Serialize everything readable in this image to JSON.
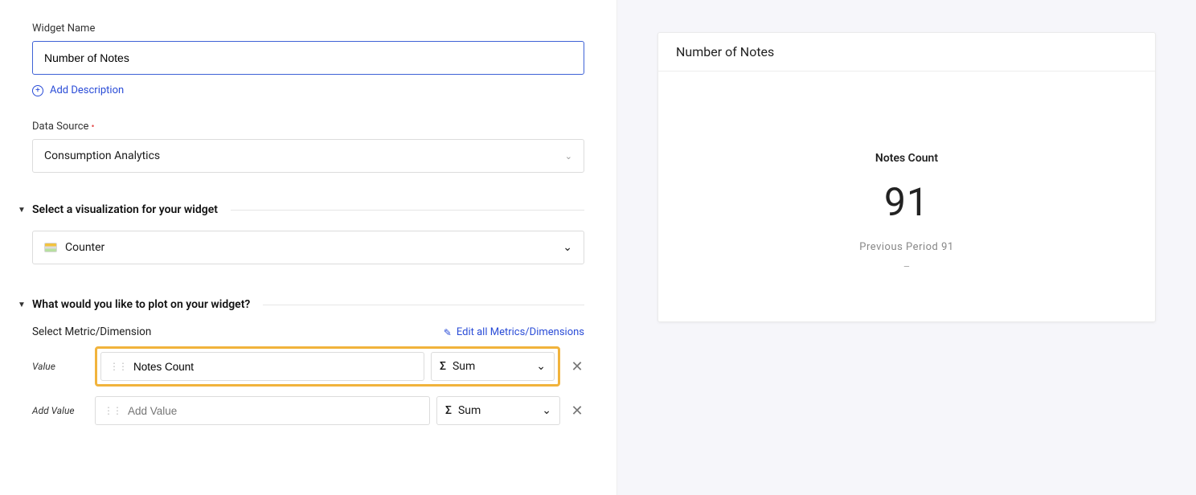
{
  "form": {
    "widget_name": {
      "label": "Widget Name",
      "value": "Number of Notes"
    },
    "add_description": "Add Description",
    "data_source": {
      "label": "Data Source",
      "value": "Consumption Analytics"
    },
    "visualization": {
      "section_title": "Select a visualization for your widget",
      "value": "Counter"
    },
    "plot": {
      "section_title": "What would you like to plot on your widget?",
      "select_label": "Select Metric/Dimension",
      "edit_link": "Edit all Metrics/Dimensions",
      "rows": [
        {
          "label": "Value",
          "metric": "Notes Count",
          "agg": "Sum",
          "highlight": true
        },
        {
          "label": "Add Value",
          "metric": "",
          "placeholder": "Add Value",
          "agg": "Sum",
          "highlight": false
        }
      ]
    }
  },
  "preview": {
    "title": "Number of Notes",
    "counter_title": "Notes Count",
    "counter_value": "91",
    "previous_period_label": "Previous Period 91",
    "dash": "–"
  },
  "chart_data": {
    "type": "table",
    "title": "Number of Notes",
    "metric": "Notes Count",
    "value": 91,
    "previous_period_value": 91
  }
}
